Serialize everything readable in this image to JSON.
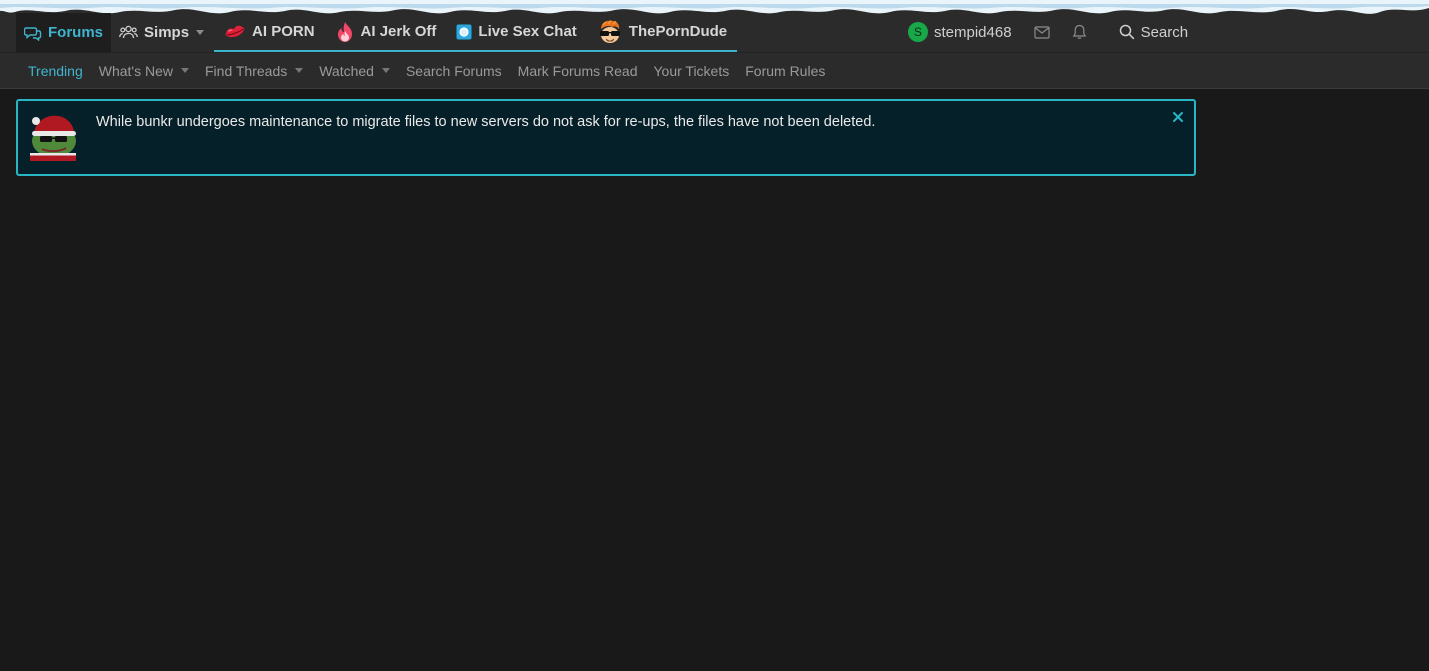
{
  "nav": {
    "tabs": [
      {
        "label": "Forums",
        "icon": "chat-bubbles-icon",
        "active": true
      },
      {
        "label": "Simps",
        "icon": "users-icon",
        "dropdown": true
      }
    ],
    "promos": [
      {
        "label": "AI PORN",
        "icon": "lips-icon"
      },
      {
        "label": "AI Jerk Off",
        "icon": "fire-icon"
      },
      {
        "label": "Live Sex Chat",
        "icon": "chat-square-icon"
      },
      {
        "label": "ThePornDude",
        "icon": "dude-face-icon"
      }
    ]
  },
  "user": {
    "avatar_letter": "S",
    "username": "stempid468",
    "avatar_color": "#18a84a"
  },
  "search": {
    "label": "Search"
  },
  "subnav": {
    "items": [
      {
        "label": "Trending",
        "active": true
      },
      {
        "label": "What's New",
        "dropdown": true
      },
      {
        "label": "Find Threads",
        "dropdown": true
      },
      {
        "label": "Watched",
        "dropdown": true
      },
      {
        "label": "Search Forums"
      },
      {
        "label": "Mark Forums Read"
      },
      {
        "label": "Your Tickets"
      },
      {
        "label": "Forum Rules"
      }
    ]
  },
  "notice": {
    "text": "While bunkr undergoes maintenance to migrate files to new servers do not ask for re-ups, the files have not been deleted.",
    "icon": "pepe-santa-avatar"
  },
  "colors": {
    "accent": "#3fb4cf",
    "notice_border": "#2ab5c5",
    "background": "#191919",
    "header": "#2b2b2b"
  }
}
